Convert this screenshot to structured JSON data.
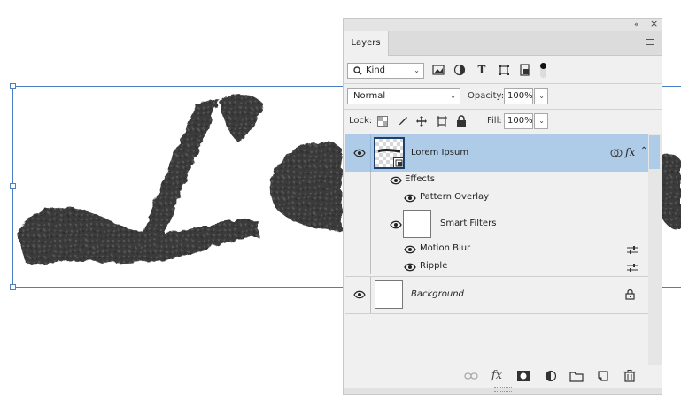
{
  "canvas": {
    "artwork_text": "Lo"
  },
  "panel": {
    "collapse_glyph": "«",
    "close_glyph": "×",
    "tab_label": "Layers",
    "filter": {
      "kind_label": "Kind"
    },
    "blend_mode": "Normal",
    "opacity_label": "Opacity:",
    "opacity_value": "100%",
    "lock_label": "Lock:",
    "fill_label": "Fill:",
    "fill_value": "100%"
  },
  "layers": {
    "lorem": {
      "name": "Lorem Ipsum",
      "effects_label": "Effects",
      "pattern_overlay": "Pattern Overlay",
      "smart_filters": "Smart Filters",
      "motion_blur": "Motion Blur",
      "ripple": "Ripple",
      "fx": "fx"
    },
    "background": {
      "name": "Background"
    }
  },
  "bottom": {
    "fx": "fx"
  },
  "colors": {
    "selection": "#aecbe8",
    "bbox": "#4a7fc4"
  }
}
